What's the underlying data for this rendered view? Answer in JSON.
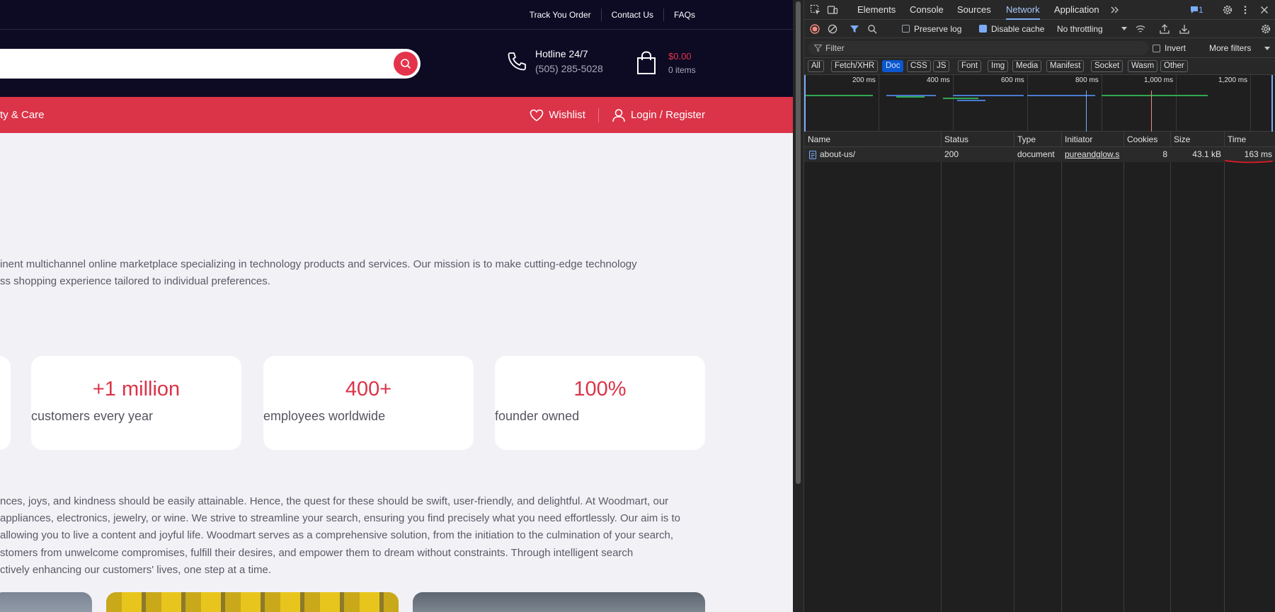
{
  "site": {
    "topbar_links": [
      "Track You Order",
      "Contact Us",
      "FAQs"
    ],
    "search_placeholder": "",
    "hotline_title": "Hotline 24/7",
    "hotline_number": "(505) 285-5028",
    "cart_total": "$0.00",
    "cart_items": "0 items",
    "nav_category_partial": "ty & Care",
    "wishlist_label": "Wishlist",
    "login_label": "Login / Register",
    "intro_line1": "inent multichannel online marketplace specializing in technology products and services. Our mission is to make cutting-edge technology",
    "intro_line2": "ss shopping experience tailored to individual preferences.",
    "stats": [
      {
        "value": "+1 million",
        "label": "customers every year"
      },
      {
        "value": "400+",
        "label": "employees worldwide"
      },
      {
        "value": "100%",
        "label": "founder owned"
      }
    ],
    "body_lines": [
      "nces, joys, and kindness should be easily attainable. Hence, the quest for these should be swift, user-friendly, and delightful. At Woodmart, our",
      "appliances, electronics, jewelry, or wine. We strive to streamline your search, ensuring you find precisely what you need effortlessly. Our aim is to",
      "allowing you to live a content and joyful life. Woodmart serves as a comprehensive solution, from the initiation to the culmination of your search,",
      "stomers from unwelcome compromises, fulfill their desires, and empower them to dream without constraints. Through intelligent search",
      "ctively enhancing our customers' lives, one step at a time."
    ]
  },
  "devtools": {
    "tabs": [
      "Elements",
      "Console",
      "Sources",
      "Network",
      "Application"
    ],
    "active_tab": "Network",
    "issues_count": "1",
    "preserve_log_label": "Preserve log",
    "disable_cache_label": "Disable cache",
    "throttling_value": "No throttling",
    "filter_placeholder": "Filter",
    "invert_label": "Invert",
    "more_filters_label": "More filters",
    "type_filters": [
      "All",
      "Fetch/XHR",
      "Doc",
      "CSS",
      "JS",
      "Font",
      "Img",
      "Media",
      "Manifest",
      "Socket",
      "Wasm",
      "Other"
    ],
    "active_type_filter": "Doc",
    "timeline_ticks": [
      "200 ms",
      "400 ms",
      "600 ms",
      "800 ms",
      "1,000 ms",
      "1,200 ms"
    ],
    "columns": [
      "Name",
      "Status",
      "Type",
      "Initiator",
      "Cookies",
      "Size",
      "Time"
    ],
    "rows": [
      {
        "name": "about-us/",
        "status": "200",
        "type": "document",
        "initiator": "pureandglow.s",
        "cookies": "8",
        "size": "43.1 kB",
        "time": "163 ms"
      }
    ],
    "colors": {
      "accent": "#7cacf8",
      "annotation": "#e01b24"
    }
  }
}
